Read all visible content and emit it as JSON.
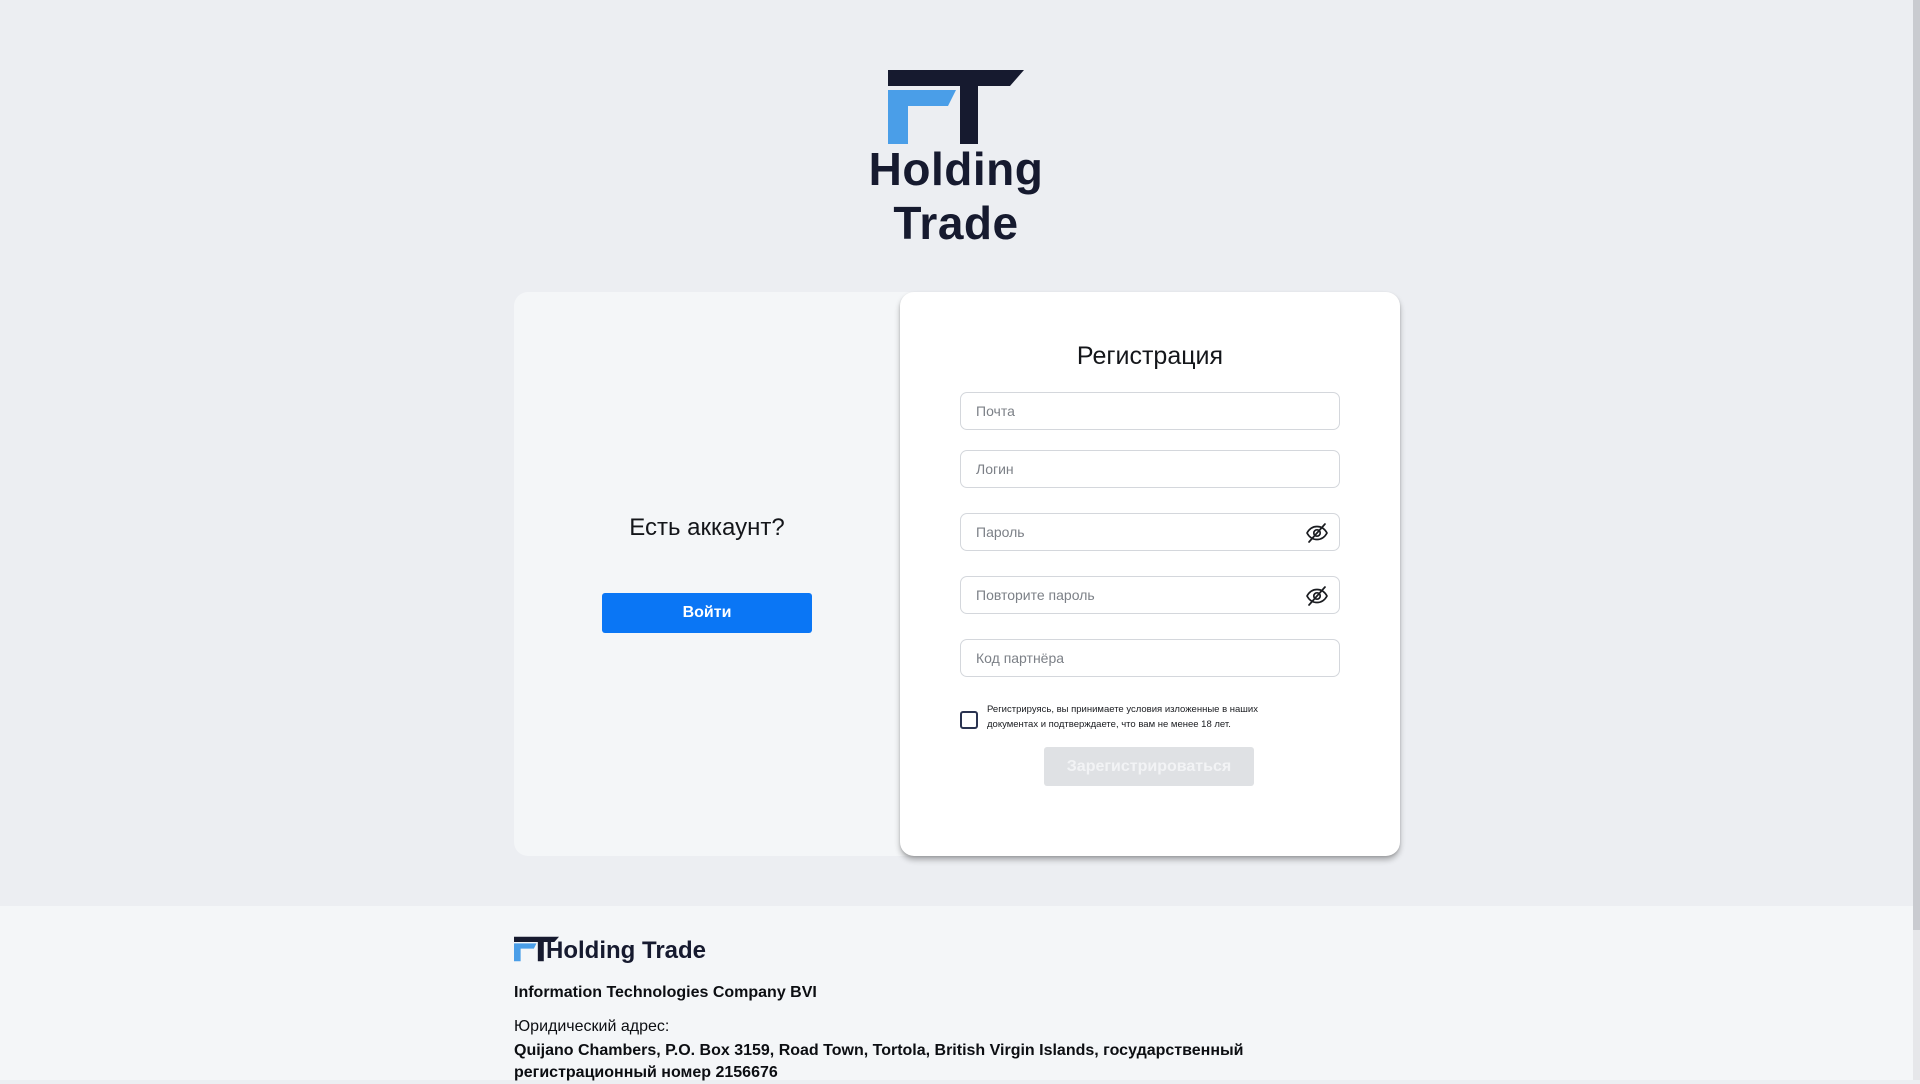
{
  "brand": {
    "name": "Holding Trade",
    "colors": {
      "dark": "#161a2f",
      "light_blue": "#4a9ee8"
    }
  },
  "login_panel": {
    "question": "Есть аккаунт?",
    "login_button": "Войти"
  },
  "registration": {
    "title": "Регистрация",
    "fields": {
      "email_placeholder": "Почта",
      "login_placeholder": "Логин",
      "password_placeholder": "Пароль",
      "repeat_password_placeholder": "Повторите пароль",
      "partner_code_placeholder": "Код партнёра"
    },
    "icons": {
      "password_toggle": "eye-slash-icon"
    },
    "agreement_text": "Регистрируясь, вы принимаете условия изложенные в наших документах и подтверждаете, что вам не менее 18 лет.",
    "agreement_checked": false,
    "register_button": "Зарегистрироваться",
    "register_enabled": false
  },
  "footer": {
    "brand_name": "Holding Trade",
    "company": "Information Technologies Company BVI",
    "address_label": "Юридический адрес:",
    "address": "Quijano Chambers, P.O. Box 3159, Road Town, Tortola, British Virgin Islands, государственный регистрационный номер 2156676"
  },
  "colors": {
    "primary_button": "#0a76f5",
    "disabled_button": "#dfe1e4",
    "page_background": "#eceef2"
  }
}
